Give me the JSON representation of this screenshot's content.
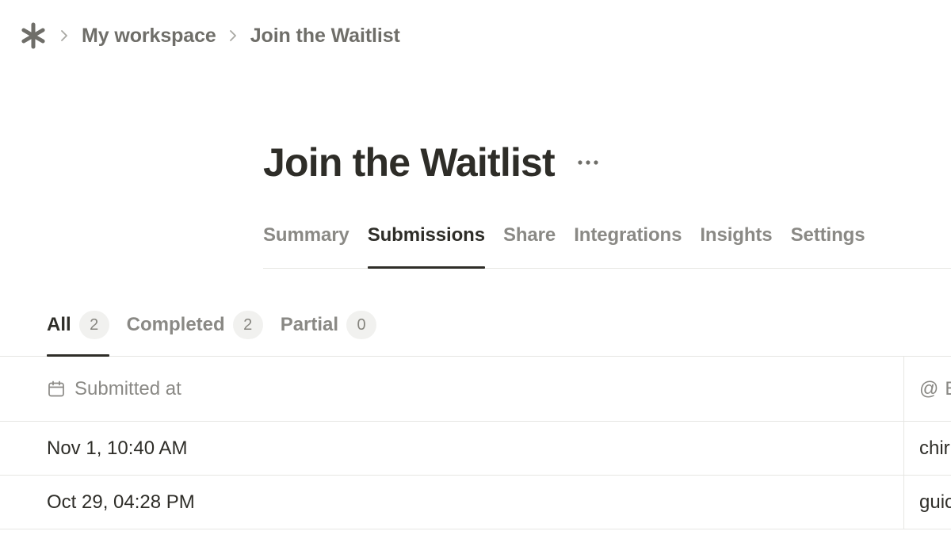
{
  "breadcrumb": {
    "logo_icon": "asterisk-icon",
    "separator_icon": "chevron-right-icon",
    "items": [
      "My workspace",
      "Join the Waitlist"
    ]
  },
  "page": {
    "title": "Join the Waitlist",
    "more_icon": "ellipsis-icon"
  },
  "main_tabs": [
    {
      "label": "Summary",
      "active": false
    },
    {
      "label": "Submissions",
      "active": true
    },
    {
      "label": "Share",
      "active": false
    },
    {
      "label": "Integrations",
      "active": false
    },
    {
      "label": "Insights",
      "active": false
    },
    {
      "label": "Settings",
      "active": false
    }
  ],
  "filter_tabs": [
    {
      "label": "All",
      "count": "2",
      "active": true
    },
    {
      "label": "Completed",
      "count": "2",
      "active": false
    },
    {
      "label": "Partial",
      "count": "0",
      "active": false
    }
  ],
  "table": {
    "columns": [
      {
        "label": "Submitted at",
        "icon": "calendar-icon"
      },
      {
        "label": "E",
        "icon": "at-sign-icon",
        "icon_glyph": "@"
      }
    ],
    "rows": [
      {
        "submitted_at": "Nov 1, 10:40 AM",
        "email": "chir"
      },
      {
        "submitted_at": "Oct 29, 04:28 PM",
        "email": "guic"
      }
    ]
  },
  "colors": {
    "text_primary": "#2e2d28",
    "text_muted": "#8a8985",
    "border": "#e6e6e3",
    "pill_bg": "#f1f1ef"
  }
}
